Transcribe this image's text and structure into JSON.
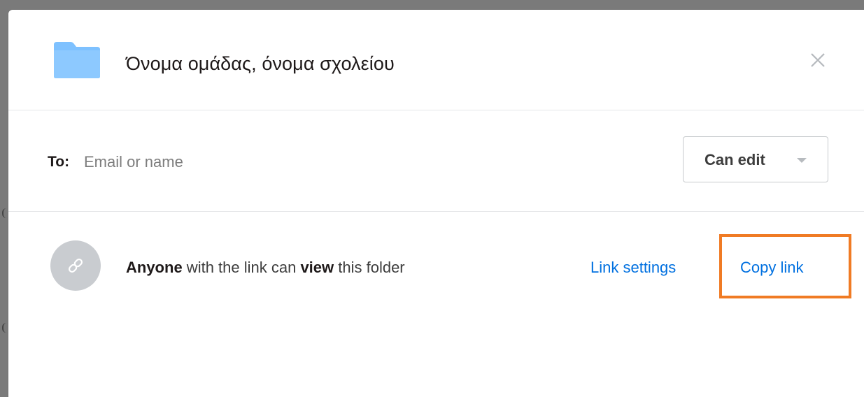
{
  "colors": {
    "accent_link": "#0070e0",
    "folder": "#7ec1ff",
    "highlight_border": "#f07b24",
    "divider": "#e4e6e8",
    "avatar_bg": "#c9ccd0"
  },
  "header": {
    "folder_icon": "folder-icon",
    "title": "Όνομα ομάδας, όνομα σχολείου",
    "close_icon": "close-icon"
  },
  "share": {
    "to_label": "To:",
    "input_placeholder": "Email or name",
    "input_value": "",
    "permission": {
      "selected": "Can edit",
      "caret_icon": "chevron-down-icon"
    }
  },
  "link": {
    "icon": "link-icon",
    "description": {
      "who": "Anyone",
      "middle": " with the link can ",
      "access": "view",
      "end": " this folder"
    },
    "settings_label": "Link settings",
    "copy_label": "Copy link"
  }
}
